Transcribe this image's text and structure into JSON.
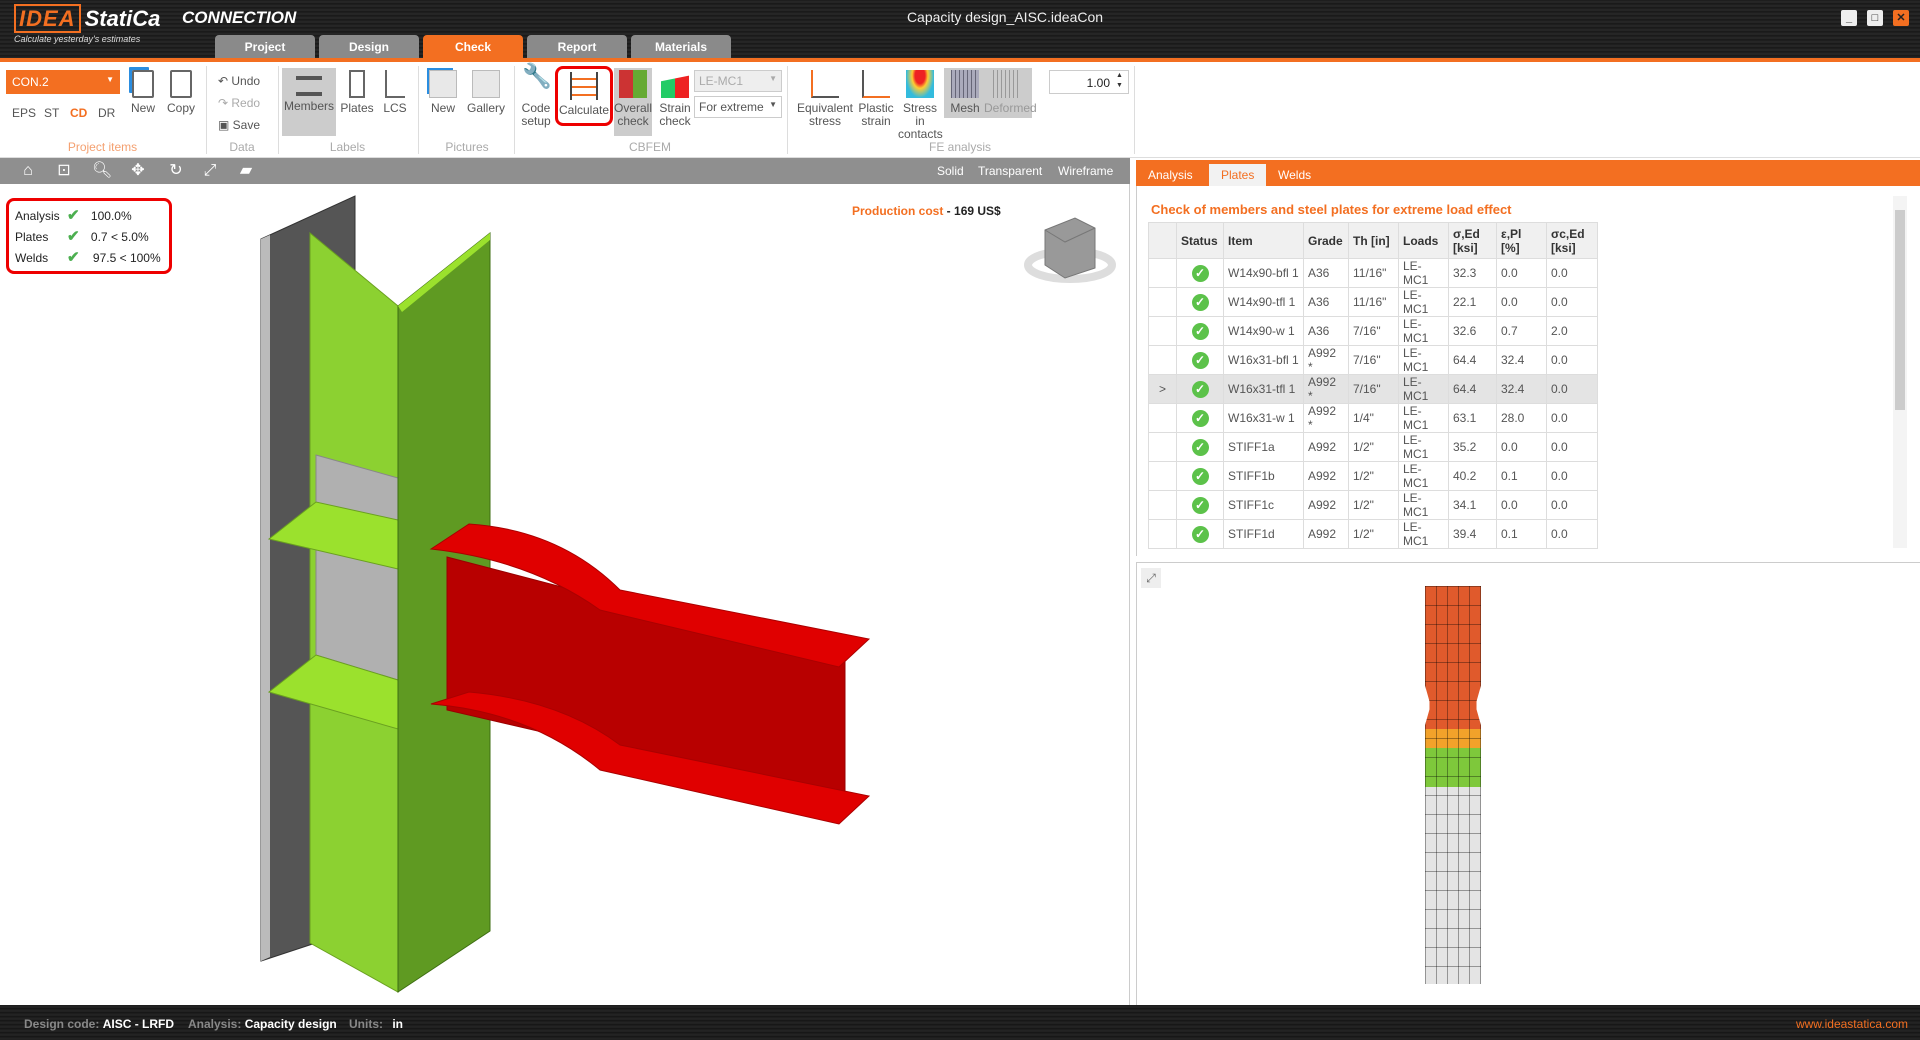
{
  "app": {
    "brand": "IDEA",
    "brand2": "StatiCa",
    "product": "CONNECTION",
    "tagline": "Calculate yesterday's estimates",
    "window_title": "Capacity design_AISC.ideaCon",
    "minimize": "_",
    "maximize": "□",
    "close": "✕"
  },
  "tabs": [
    {
      "label": "Project"
    },
    {
      "label": "Design"
    },
    {
      "label": "Check"
    },
    {
      "label": "Report"
    },
    {
      "label": "Materials"
    }
  ],
  "ribbon": {
    "project_items": {
      "combo": "CON.2",
      "modes": [
        "EPS",
        "ST",
        "CD",
        "DR"
      ],
      "new": "New",
      "copy": "Copy",
      "label": "Project items"
    },
    "data": {
      "undo": "Undo",
      "redo": "Redo",
      "save": "Save",
      "label": "Data"
    },
    "labels": {
      "members": "Members",
      "plates": "Plates",
      "lcs": "LCS",
      "label": "Labels"
    },
    "pictures": {
      "new": "New",
      "gallery": "Gallery",
      "label": "Pictures"
    },
    "cbfem": {
      "code1": "Code",
      "code2": "setup",
      "calculate": "Calculate",
      "overall1": "Overall",
      "overall2": "check",
      "strain1": "Strain",
      "strain2": "check",
      "load": "LE-MC1",
      "extreme": "For extreme",
      "label": "CBFEM"
    },
    "fe": {
      "eq1": "Equivalent",
      "eq2": "stress",
      "pl1": "Plastic",
      "pl2": "strain",
      "sc1": "Stress in",
      "sc2": "contacts",
      "mesh": "Mesh",
      "deformed": "Deformed",
      "scale": "1.00",
      "label": "FE analysis"
    }
  },
  "view": {
    "modes": [
      "Solid",
      "Transparent",
      "Wireframe"
    ],
    "production_label": "Production cost",
    "production_value": "169 US$",
    "summary": [
      {
        "label": "Analysis",
        "value": "100.0%"
      },
      {
        "label": "Plates",
        "value": "0.7 < 5.0%"
      },
      {
        "label": "Welds",
        "value": "97.5 < 100%"
      }
    ]
  },
  "right": {
    "tabs": [
      "Analysis",
      "Plates",
      "Welds"
    ],
    "title": "Check of members and steel plates for extreme load effect",
    "headers": [
      "",
      "Status",
      "Item",
      "Grade",
      "Th [in]",
      "Loads",
      "σ,Ed [ksi]",
      "ε,Pl [%]",
      "σc,Ed [ksi]"
    ],
    "rows": [
      [
        "",
        "W14x90-bfl 1",
        "A36",
        "11/16\"",
        "LE-MC1",
        "32.3",
        "0.0",
        "0.0"
      ],
      [
        "",
        "W14x90-tfl 1",
        "A36",
        "11/16\"",
        "LE-MC1",
        "22.1",
        "0.0",
        "0.0"
      ],
      [
        "",
        "W14x90-w 1",
        "A36",
        "7/16\"",
        "LE-MC1",
        "32.6",
        "0.7",
        "2.0"
      ],
      [
        "",
        "W16x31-bfl 1",
        "A992 *",
        "7/16\"",
        "LE-MC1",
        "64.4",
        "32.4",
        "0.0"
      ],
      [
        ">",
        "W16x31-tfl 1",
        "A992 *",
        "7/16\"",
        "LE-MC1",
        "64.4",
        "32.4",
        "0.0"
      ],
      [
        "",
        "W16x31-w 1",
        "A992 *",
        "1/4\"",
        "LE-MC1",
        "63.1",
        "28.0",
        "0.0"
      ],
      [
        "",
        "STIFF1a",
        "A992",
        "1/2\"",
        "LE-MC1",
        "35.2",
        "0.0",
        "0.0"
      ],
      [
        "",
        "STIFF1b",
        "A992",
        "1/2\"",
        "LE-MC1",
        "40.2",
        "0.1",
        "0.0"
      ],
      [
        "",
        "STIFF1c",
        "A992",
        "1/2\"",
        "LE-MC1",
        "34.1",
        "0.0",
        "0.0"
      ],
      [
        "",
        "STIFF1d",
        "A992",
        "1/2\"",
        "LE-MC1",
        "39.4",
        "0.1",
        "0.0"
      ]
    ],
    "selected_row": 4
  },
  "status": {
    "code_label": "Design code:",
    "code": "AISC - LRFD",
    "analysis_label": "Analysis:",
    "analysis": "Capacity design",
    "units_label": "Units:",
    "units": "in",
    "website": "www.ideastatica.com"
  },
  "colors": {
    "accent": "#f36f21",
    "ok": "#5cc24a",
    "beam": "#d40000",
    "column": "#8cd131"
  }
}
